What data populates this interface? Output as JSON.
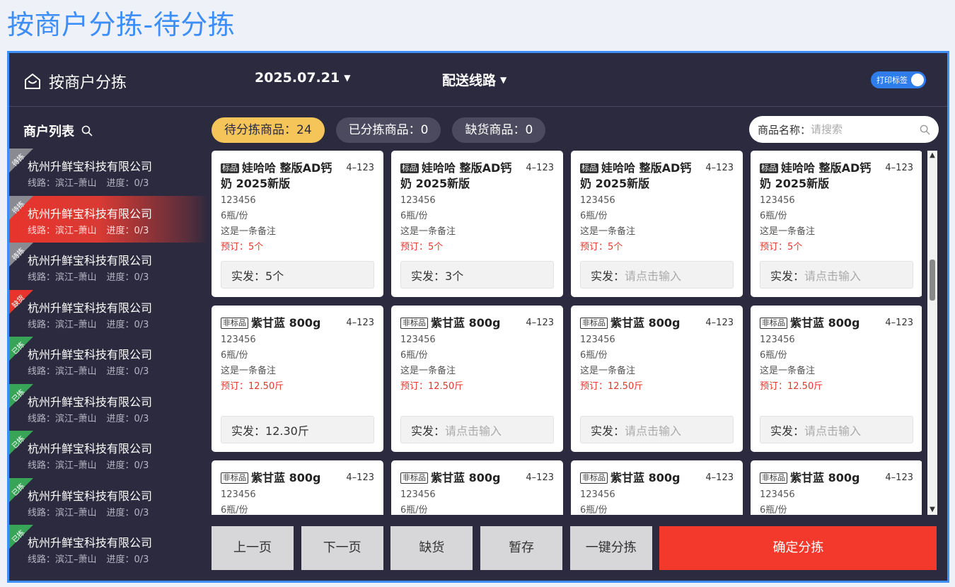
{
  "page_title": "按商户分拣-待分拣",
  "header": {
    "title": "按商户分拣",
    "date": "2025.07.21",
    "route_label": "配送线路",
    "print_toggle_label": "打印标签",
    "print_toggle_on": true
  },
  "sidebar": {
    "title": "商户列表",
    "items": [
      {
        "name": "杭州升鲜宝科技有限公司",
        "route": "线路：滨江–萧山",
        "progress": "进度：0/3",
        "tag": "待拣",
        "tag_color": "#8a8a93",
        "active": false
      },
      {
        "name": "杭州升鲜宝科技有限公司",
        "route": "线路：滨江–萧山",
        "progress": "进度：0/3",
        "tag": "待拣",
        "tag_color": "#8a8a93",
        "active": true
      },
      {
        "name": "杭州升鲜宝科技有限公司",
        "route": "线路：滨江–萧山",
        "progress": "进度：0/3",
        "tag": "待拣",
        "tag_color": "#8a8a93",
        "active": false
      },
      {
        "name": "杭州升鲜宝科技有限公司",
        "route": "线路：滨江–萧山",
        "progress": "进度：0/3",
        "tag": "缺货",
        "tag_color": "#e8342c",
        "active": false
      },
      {
        "name": "杭州升鲜宝科技有限公司",
        "route": "线路：滨江–萧山",
        "progress": "进度：0/3",
        "tag": "已拣",
        "tag_color": "#37a457",
        "active": false
      },
      {
        "name": "杭州升鲜宝科技有限公司",
        "route": "线路：滨江–萧山",
        "progress": "进度：0/3",
        "tag": "已拣",
        "tag_color": "#37a457",
        "active": false
      },
      {
        "name": "杭州升鲜宝科技有限公司",
        "route": "线路：滨江–萧山",
        "progress": "进度：0/3",
        "tag": "已拣",
        "tag_color": "#37a457",
        "active": false
      },
      {
        "name": "杭州升鲜宝科技有限公司",
        "route": "线路：滨江–萧山",
        "progress": "进度：0/3",
        "tag": "已拣",
        "tag_color": "#37a457",
        "active": false
      },
      {
        "name": "杭州升鲜宝科技有限公司",
        "route": "线路：滨江–萧山",
        "progress": "进度：0/3",
        "tag": "已拣",
        "tag_color": "#37a457",
        "active": false
      }
    ]
  },
  "tabs": [
    {
      "label": "待分拣商品：24",
      "active": true
    },
    {
      "label": "已分拣商品：0",
      "active": false
    },
    {
      "label": "缺货商品：0",
      "active": false
    }
  ],
  "search": {
    "label": "商品名称：",
    "placeholder": "请搜索",
    "value": ""
  },
  "cards": [
    {
      "badge": "标品",
      "badge_type": "std",
      "name": "娃哈哈 整版AD钙奶 2025新版",
      "slot": "4–123",
      "code": "123456",
      "spec": "6瓶/份",
      "note": "这是一条备注",
      "order": "预订：5个",
      "actual_label": "实发：",
      "actual_value": "5个",
      "placeholder": "请点击输入"
    },
    {
      "badge": "标品",
      "badge_type": "std",
      "name": "娃哈哈 整版AD钙奶 2025新版",
      "slot": "4–123",
      "code": "123456",
      "spec": "6瓶/份",
      "note": "这是一条备注",
      "order": "预订：5个",
      "actual_label": "实发：",
      "actual_value": "3个",
      "placeholder": "请点击输入"
    },
    {
      "badge": "标品",
      "badge_type": "std",
      "name": "娃哈哈 整版AD钙奶 2025新版",
      "slot": "4–123",
      "code": "123456",
      "spec": "6瓶/份",
      "note": "这是一条备注",
      "order": "预订：5个",
      "actual_label": "实发：",
      "actual_value": "",
      "placeholder": "请点击输入"
    },
    {
      "badge": "标品",
      "badge_type": "std",
      "name": "娃哈哈 整版AD钙奶 2025新版",
      "slot": "4–123",
      "code": "123456",
      "spec": "6瓶/份",
      "note": "这是一条备注",
      "order": "预订：5个",
      "actual_label": "实发：",
      "actual_value": "",
      "placeholder": "请点击输入"
    },
    {
      "badge": "非标品",
      "badge_type": "nstd",
      "name": "紫甘蓝 800g",
      "slot": "4–123",
      "code": "123456",
      "spec": "6瓶/份",
      "note": "这是一条备注",
      "order": "预订：12.50斤",
      "actual_label": "实发：",
      "actual_value": "12.30斤",
      "placeholder": "请点击输入"
    },
    {
      "badge": "非标品",
      "badge_type": "nstd",
      "name": "紫甘蓝 800g",
      "slot": "4–123",
      "code": "123456",
      "spec": "6瓶/份",
      "note": "这是一条备注",
      "order": "预订：12.50斤",
      "actual_label": "实发：",
      "actual_value": "",
      "placeholder": "请点击输入"
    },
    {
      "badge": "非标品",
      "badge_type": "nstd",
      "name": "紫甘蓝 800g",
      "slot": "4–123",
      "code": "123456",
      "spec": "6瓶/份",
      "note": "这是一条备注",
      "order": "预订：12.50斤",
      "actual_label": "实发：",
      "actual_value": "",
      "placeholder": "请点击输入"
    },
    {
      "badge": "非标品",
      "badge_type": "nstd",
      "name": "紫甘蓝 800g",
      "slot": "4–123",
      "code": "123456",
      "spec": "6瓶/份",
      "note": "这是一条备注",
      "order": "预订：12.50斤",
      "actual_label": "实发：",
      "actual_value": "",
      "placeholder": "请点击输入"
    },
    {
      "badge": "非标品",
      "badge_type": "nstd",
      "name": "紫甘蓝 800g",
      "slot": "4–123",
      "code": "123456",
      "spec": "6瓶/份",
      "note": "",
      "order": "",
      "actual_label": "",
      "actual_value": "",
      "placeholder": ""
    },
    {
      "badge": "非标品",
      "badge_type": "nstd",
      "name": "紫甘蓝 800g",
      "slot": "4–123",
      "code": "123456",
      "spec": "6瓶/份",
      "note": "",
      "order": "",
      "actual_label": "",
      "actual_value": "",
      "placeholder": ""
    },
    {
      "badge": "非标品",
      "badge_type": "nstd",
      "name": "紫甘蓝 800g",
      "slot": "4–123",
      "code": "123456",
      "spec": "6瓶/份",
      "note": "",
      "order": "",
      "actual_label": "",
      "actual_value": "",
      "placeholder": ""
    },
    {
      "badge": "非标品",
      "badge_type": "nstd",
      "name": "紫甘蓝 800g",
      "slot": "4–123",
      "code": "123456",
      "spec": "6瓶/份",
      "note": "",
      "order": "",
      "actual_label": "",
      "actual_value": "",
      "placeholder": ""
    }
  ],
  "buttons": {
    "prev": "上一页",
    "next": "下一页",
    "out_of_stock": "缺货",
    "save_draft": "暂存",
    "one_click_sort": "一键分拣",
    "confirm_sort": "确定分拣"
  },
  "colors": {
    "accent_blue": "#3d8ef8",
    "panel_bg": "#2c2a3f",
    "active_tab": "#f5c55a",
    "danger_red": "#f2392c"
  }
}
